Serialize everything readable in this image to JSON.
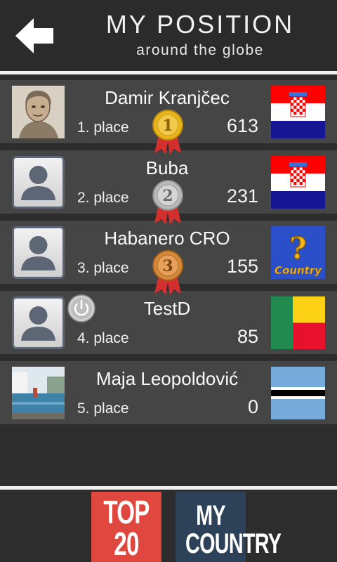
{
  "header": {
    "title": "MY POSITION",
    "subtitle": "around the globe",
    "back_icon": "back-arrow-icon"
  },
  "rows": [
    {
      "name": "Damir Kranjčec",
      "place": "1. place",
      "score": "613",
      "medal": "1",
      "medal_color": "#e9b51b",
      "avatar": "photo-portrait",
      "flag": "croatia"
    },
    {
      "name": "Buba",
      "place": "2. place",
      "score": "231",
      "medal": "2",
      "medal_color": "#b9b9b9",
      "avatar": "default-user",
      "flag": "croatia"
    },
    {
      "name": "Habanero CRO",
      "place": "3. place",
      "score": "155",
      "medal": "3",
      "medal_color": "#d58a3a",
      "avatar": "default-user",
      "flag": "unknown-country"
    },
    {
      "name": "TestD",
      "place": "4. place",
      "score": "85",
      "avatar": "default-user",
      "flag": "benin",
      "icon": "power-icon"
    },
    {
      "name": "Maja Leopoldović",
      "place": "5. place",
      "score": "0",
      "avatar": "photo-pool",
      "flag": "botswana"
    }
  ],
  "unknown_flag": {
    "symbol": "?",
    "label": "Country"
  },
  "footer": {
    "top20": {
      "line1": "TOP",
      "line2": "20",
      "color": "#e0473f"
    },
    "my_country": {
      "line1": "MY",
      "line2": "COUNTRY",
      "color": "#2d4258"
    }
  }
}
